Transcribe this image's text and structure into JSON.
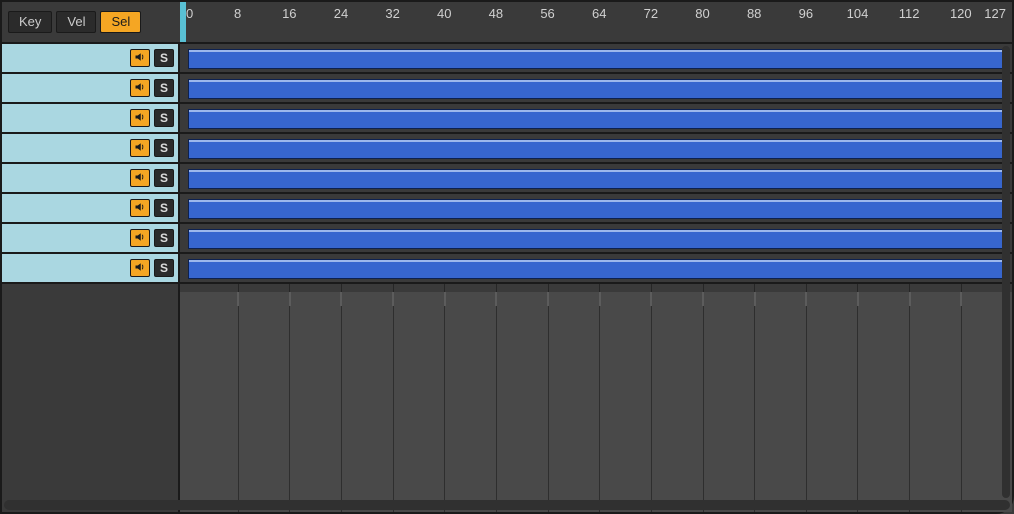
{
  "tabs": {
    "key": "Key",
    "vel": "Vel",
    "sel": "Sel",
    "active": "sel"
  },
  "ruler": {
    "start": 0,
    "end": 127,
    "marks": [
      0,
      8,
      16,
      24,
      32,
      40,
      48,
      56,
      64,
      72,
      80,
      88,
      96,
      104,
      112,
      120,
      127
    ]
  },
  "tracks": [
    {
      "speaker_on": true,
      "solo": "S"
    },
    {
      "speaker_on": true,
      "solo": "S"
    },
    {
      "speaker_on": true,
      "solo": "S"
    },
    {
      "speaker_on": true,
      "solo": "S"
    },
    {
      "speaker_on": true,
      "solo": "S"
    },
    {
      "speaker_on": true,
      "solo": "S"
    },
    {
      "speaker_on": true,
      "solo": "S"
    },
    {
      "speaker_on": true,
      "solo": "S"
    }
  ],
  "colors": {
    "accent": "#f5a623",
    "track_bg": "#aad7e1",
    "clip": "#3766cf",
    "playhead": "#59c0d4"
  },
  "icons": {
    "speaker": "speaker-icon"
  }
}
